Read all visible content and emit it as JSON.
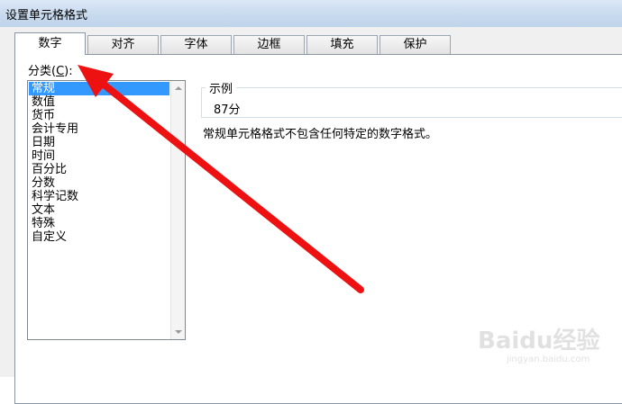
{
  "window": {
    "title": "设置单元格格式"
  },
  "tabs": [
    {
      "label": "数字",
      "active": true
    },
    {
      "label": "对齐",
      "active": false
    },
    {
      "label": "字体",
      "active": false
    },
    {
      "label": "边框",
      "active": false
    },
    {
      "label": "填充",
      "active": false
    },
    {
      "label": "保护",
      "active": false
    }
  ],
  "category": {
    "label_prefix": "分类(",
    "label_key": "C",
    "label_suffix": "):",
    "items": [
      "常规",
      "数值",
      "货币",
      "会计专用",
      "日期",
      "时间",
      "百分比",
      "分数",
      "科学记数",
      "文本",
      "特殊",
      "自定义"
    ],
    "selected": "常规"
  },
  "sample": {
    "legend": "示例",
    "value": "87分"
  },
  "description": "常规单元格格式不包含任何特定的数字格式。",
  "annotation": {
    "arrow_color": "#ee1111"
  },
  "watermark": {
    "brand": "Baidu经验",
    "site": "jingyan.baidu.com"
  },
  "colors": {
    "selection": "#3399ff",
    "titlebar": "#c7d9ee"
  },
  "icons": {
    "scroll_up": "triangle-up-icon",
    "scroll_down": "triangle-down-icon"
  }
}
